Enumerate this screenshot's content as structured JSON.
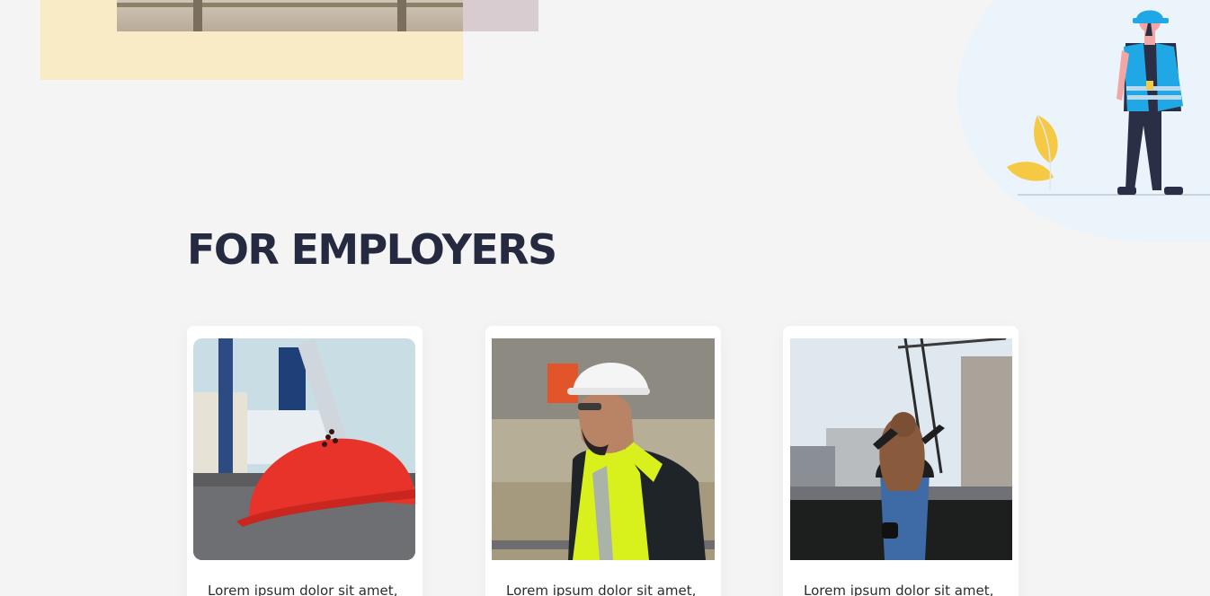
{
  "section": {
    "title": "FOR EMPLOYERS"
  },
  "cards": [
    {
      "image": "red-hard-hat-photo",
      "text": "Lorem ipsum dolor sit amet,"
    },
    {
      "image": "worker-in-safety-vest-photo",
      "text": "Lorem ipsum dolor sit amet,"
    },
    {
      "image": "woman-viewing-construction-crane-photo",
      "text": "Lorem ipsum dolor sit amet,"
    }
  ],
  "colors": {
    "background": "#f4f4f4",
    "heading": "#252a40",
    "accent_yellow": "#f8ebc6",
    "illustration_blue": "#1fa7e6",
    "leaf_yellow": "#f6c945"
  }
}
